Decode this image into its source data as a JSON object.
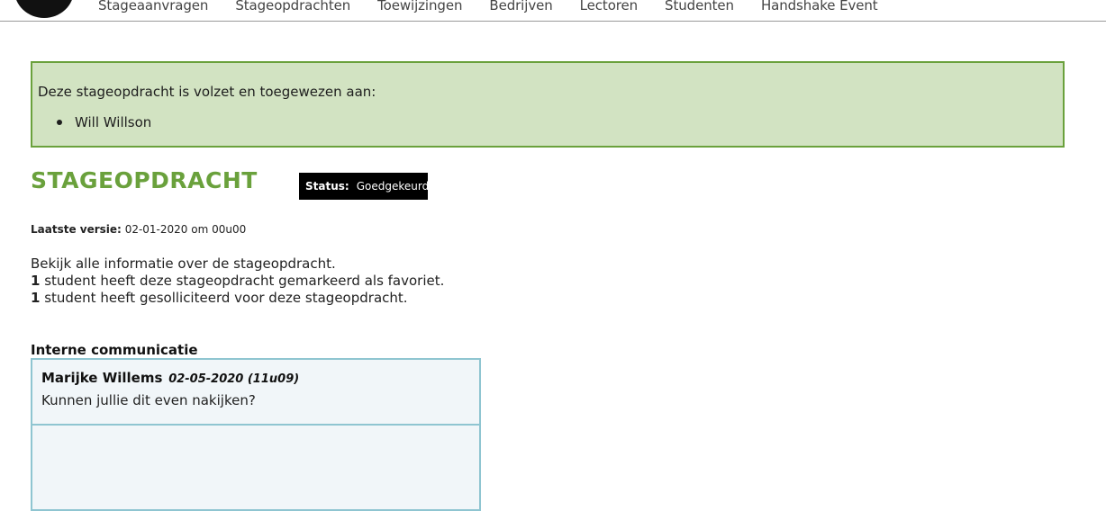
{
  "nav": {
    "items": [
      {
        "label": "Stageaanvragen"
      },
      {
        "label": "Stageopdrachten"
      },
      {
        "label": "Toewijzingen"
      },
      {
        "label": "Bedrijven"
      },
      {
        "label": "Lectoren"
      },
      {
        "label": "Studenten"
      },
      {
        "label": "Handshake Event"
      }
    ]
  },
  "alert": {
    "text": "Deze stageopdracht is volzet en toegewezen aan:",
    "assignees": [
      "Will Willson"
    ],
    "background_color": "#d2e3c2",
    "border_color": "#6aa13c"
  },
  "header": {
    "title": "STAGEOPDRACHT",
    "title_color": "#6aa13c",
    "status_label": "Status:",
    "status_value": "Goedgekeurd"
  },
  "version": {
    "label": "Laatste versie:",
    "value": "02-01-2020 om 00u00"
  },
  "info": {
    "line1": "Bekijk alle informatie over de stageopdracht.",
    "favorites_count": "1",
    "favorites_text": " student heeft deze stageopdracht gemarkeerd als favoriet.",
    "applications_count": "1",
    "applications_text": " student heeft gesolliciteerd voor deze stageopdracht."
  },
  "communication": {
    "heading": "Interne communicatie",
    "border_color": "#8fc5d1",
    "messages": [
      {
        "author": "Marijke Willems",
        "date": "02-05-2020 (11u09)",
        "text": "Kunnen jullie dit even nakijken?"
      }
    ]
  }
}
